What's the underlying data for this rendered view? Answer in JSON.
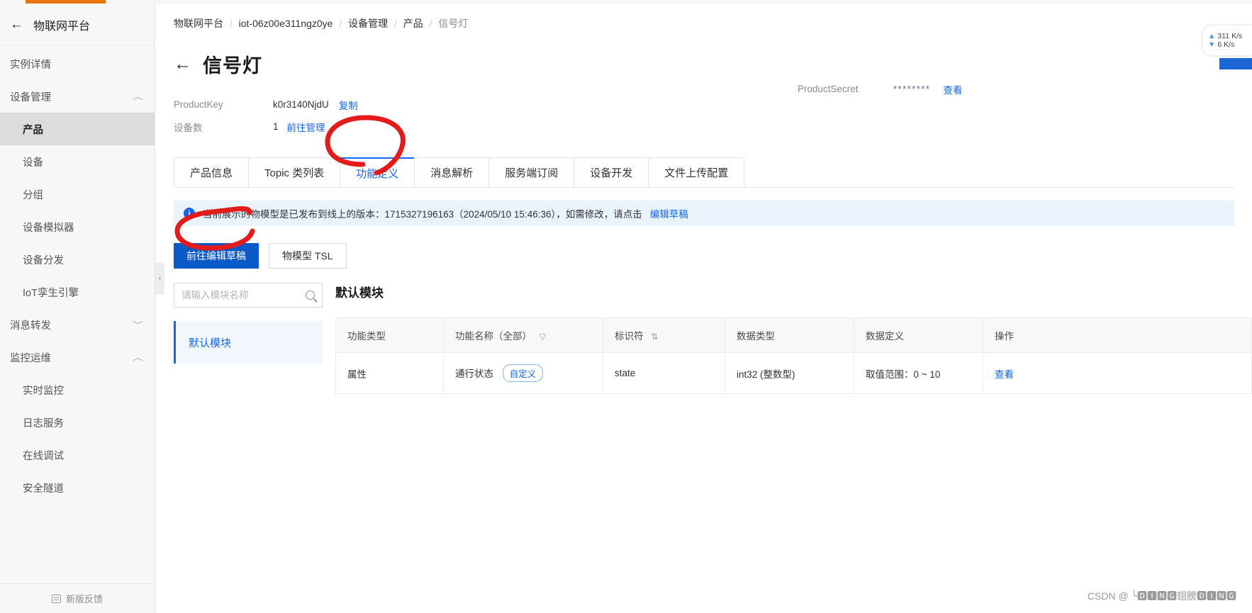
{
  "sidebar": {
    "back_icon": "arrow-left-icon",
    "title": "物联网平台",
    "items": [
      {
        "label": "实例详情",
        "type": "plain"
      },
      {
        "label": "设备管理",
        "type": "group",
        "chevron": "︿"
      },
      {
        "label": "产品",
        "type": "child",
        "active": true
      },
      {
        "label": "设备",
        "type": "child"
      },
      {
        "label": "分组",
        "type": "child"
      },
      {
        "label": "设备模拟器",
        "type": "child"
      },
      {
        "label": "设备分发",
        "type": "child"
      },
      {
        "label": "IoT孪生引擎",
        "type": "child"
      },
      {
        "label": "消息转发",
        "type": "group",
        "chevron": "﹀"
      },
      {
        "label": "监控运维",
        "type": "group",
        "chevron": "︿"
      },
      {
        "label": "实时监控",
        "type": "child"
      },
      {
        "label": "日志服务",
        "type": "child"
      },
      {
        "label": "在线调试",
        "type": "child"
      },
      {
        "label": "安全隧道",
        "type": "child"
      }
    ],
    "footer_label": "新版反馈",
    "collapse_handle": "‹"
  },
  "breadcrumb": [
    "物联网平台",
    "iot-06z00e311ngz0ye",
    "设备管理",
    "产品",
    "信号灯"
  ],
  "breadcrumb_separator": "/",
  "page": {
    "back_arrow": "←",
    "title": "信号灯"
  },
  "meta": {
    "product_key_label": "ProductKey",
    "product_key_value": "k0r3140NjdU",
    "copy_label": "复制",
    "device_count_label": "设备数",
    "device_count_value": "1",
    "goto_manage_label": "前往管理",
    "product_secret_label": "ProductSecret",
    "product_secret_value": "********",
    "view_label": "查看"
  },
  "tabs": [
    {
      "label": "产品信息",
      "active": false
    },
    {
      "label": "Topic 类列表",
      "active": false
    },
    {
      "label": "功能定义",
      "active": true
    },
    {
      "label": "消息解析",
      "active": false
    },
    {
      "label": "服务端订阅",
      "active": false
    },
    {
      "label": "设备开发",
      "active": false
    },
    {
      "label": "文件上传配置",
      "active": false
    }
  ],
  "banner": {
    "icon": "info-icon",
    "icon_glyph": "i",
    "text": "当前展示的物模型是已发布到线上的版本：1715327196163（2024/05/10 15:46:36），如需修改，请点击",
    "link": "编辑草稿"
  },
  "actions": {
    "primary": "前往编辑草稿",
    "secondary": "物模型 TSL"
  },
  "module_pane": {
    "search_placeholder": "请输入模块名称",
    "search_value": "",
    "search_icon": "search-icon",
    "modules": [
      "默认模块"
    ]
  },
  "table": {
    "title": "默认模块",
    "columns": [
      {
        "label": "功能类型",
        "icon": ""
      },
      {
        "label": "功能名称（全部）",
        "icon": "filter-icon"
      },
      {
        "label": "标识符",
        "icon": "sort-icon"
      },
      {
        "label": "数据类型",
        "icon": ""
      },
      {
        "label": "数据定义",
        "icon": ""
      },
      {
        "label": "操作",
        "icon": ""
      }
    ],
    "rows": [
      {
        "function_type": "属性",
        "function_name": "通行状态",
        "function_tag": "自定义",
        "identifier": "state",
        "data_type": "int32 (整数型)",
        "data_definition": "取值范围：0 ~ 10",
        "action": "查看"
      }
    ]
  },
  "net_pill": {
    "up": "311 K/s",
    "down": "6  K/s",
    "up_icon": "arrow-up-icon",
    "down_icon": "arrow-down-icon"
  },
  "watermark": "CSDN @ ╰🅳🅸🅽🅶翅膀🅳🅸🅽🅶",
  "colors": {
    "accent": "#1366ec",
    "primary_button": "#0a59c9",
    "banner_bg": "#e8f3fe",
    "annotation": "#e41b1b",
    "sidebar_bg": "#f7f7f7"
  }
}
